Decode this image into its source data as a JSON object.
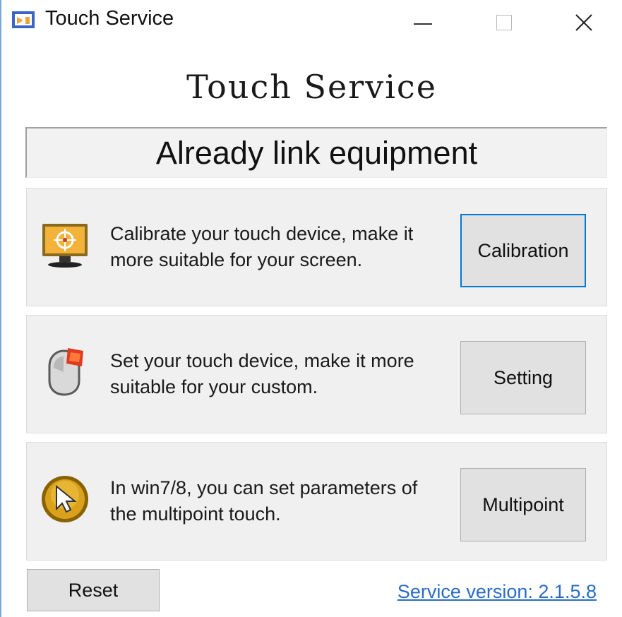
{
  "window": {
    "title": "Touch Service",
    "controls": {
      "minimize": "minimize",
      "maximize": "maximize",
      "close": "close"
    }
  },
  "heading": "Touch Service",
  "status_text": "Already link equipment",
  "panels": [
    {
      "icon": "monitor-crosshair-icon",
      "description": "Calibrate your touch device, make it more suitable for your screen.",
      "button_label": "Calibration"
    },
    {
      "icon": "mouse-settings-icon",
      "description": "Set your touch device, make it more suitable for your custom.",
      "button_label": "Setting"
    },
    {
      "icon": "cursor-arrow-icon",
      "description": "In win7/8, you can set parameters of the multipoint touch.",
      "button_label": "Multipoint"
    }
  ],
  "footer": {
    "reset_label": "Reset",
    "version_label": "Service version: 2.1.5.8"
  },
  "colors": {
    "accent": "#0078d7",
    "link": "#2a6cc4",
    "panel_bg": "#f0f0f0",
    "button_bg": "#e1e1e1"
  }
}
